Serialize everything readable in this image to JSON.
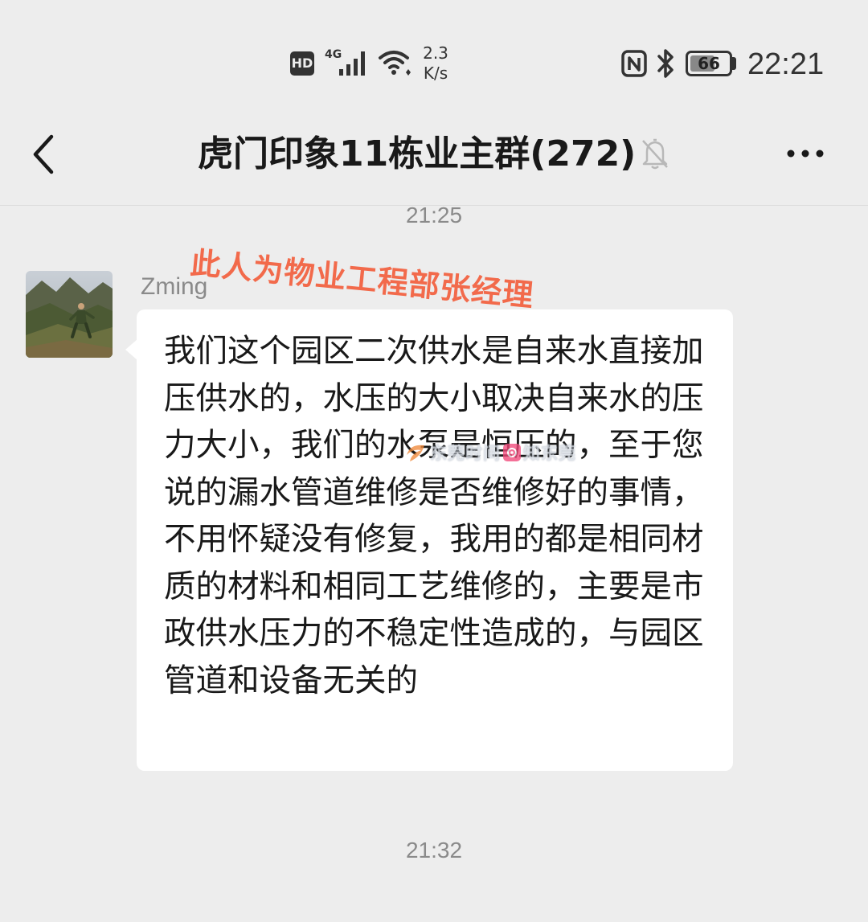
{
  "status_bar": {
    "hd": "HD",
    "network": "4G",
    "speed_value": "2.3",
    "speed_unit": "K/s",
    "battery": "66",
    "battery_level_percent": 66,
    "time": "22:21",
    "icons": [
      "hd-icon",
      "signal-icon",
      "wifi-icon",
      "nfc-icon",
      "bluetooth-icon",
      "battery-icon"
    ]
  },
  "header": {
    "title": "虎门印象11栋业主群(272)",
    "icons": [
      "back-arrow-icon",
      "muted-bell-icon",
      "more-icon"
    ]
  },
  "chat": {
    "timestamp_1": "21:25",
    "annotation": "此人为物业工程部张经理",
    "message": {
      "sender": "Zming",
      "text": "我们这个园区二次供水是自来水直接加压供水的，水压的大小取决自来水的压力大小，我们的水泵是恒压的，至于您说的漏水管道维修是否维修好的事情，不用怀疑没有修复，我用的都是相同材质的材料和相同工艺维修的，主要是市政供水压力的不稳定性造成的，与园区管道和设备无关的"
    },
    "watermark": {
      "left_text": "东莞时间",
      "right_text": "知东莞"
    },
    "timestamp_2": "21:32"
  },
  "colors": {
    "background": "#ededed",
    "bubble": "#ffffff",
    "annotation": "#f26a4b",
    "timestamp": "#8a8a8a"
  }
}
